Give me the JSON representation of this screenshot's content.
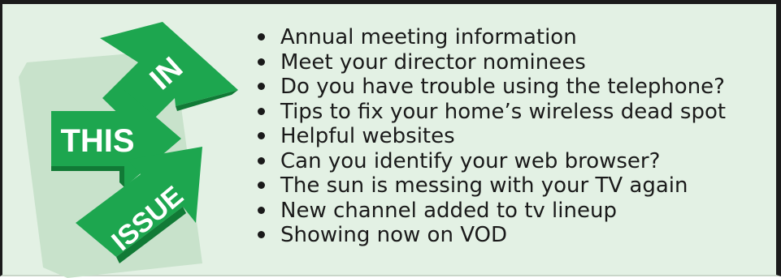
{
  "graphic": {
    "word_in": "IN",
    "word_this": "THIS",
    "word_issue": "ISSUE",
    "colors": {
      "arrow_green": "#1da64f",
      "background_paper": "#c8e2cb",
      "panel": "#e3f1e4"
    }
  },
  "contents": {
    "items": [
      "Annual meeting information",
      "Meet your director nominees",
      "Do you have trouble using the telephone?",
      "Tips to fix your home’s wireless dead spot",
      "Helpful websites",
      "Can you identify your web browser?",
      "The sun is messing with your TV again",
      "New channel added to tv lineup",
      "Showing now on VOD"
    ]
  }
}
